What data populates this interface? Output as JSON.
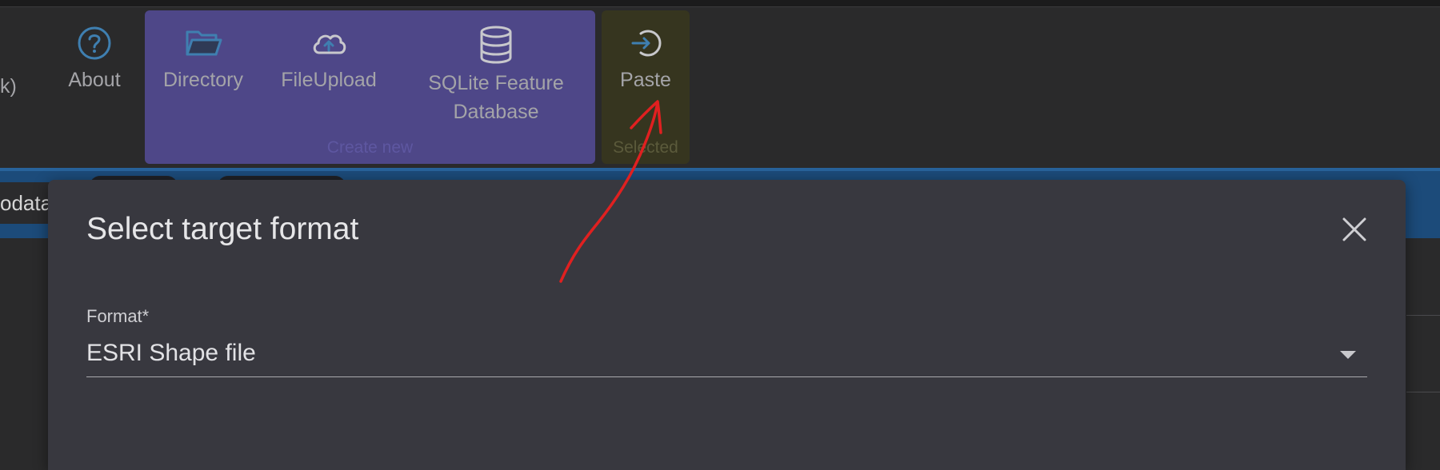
{
  "toolbar": {
    "partial_label": "k)",
    "about_label": "About",
    "create_group": {
      "label": "Create new",
      "items": [
        {
          "label": "Directory",
          "icon": "folder-icon"
        },
        {
          "label": "FileUpload",
          "icon": "cloud-upload-icon"
        },
        {
          "label_line1": "SQLite Feature",
          "label_line2": "Database",
          "icon": "database-icon"
        }
      ]
    },
    "selected_group": {
      "label": "Selected",
      "paste_label": "Paste",
      "paste_icon": "paste-arrow-icon"
    }
  },
  "tabs": {
    "partial_tab_label": "odata"
  },
  "dialog": {
    "title": "Select target format",
    "close_icon": "close-icon",
    "format_label": "Format*",
    "format_value": "ESRI Shape file"
  },
  "colors": {
    "create_group_bg": "#4e4788",
    "selected_group_bg": "#36351f",
    "accent_blue": "#1c4b7a",
    "icon_blue": "#3f7fb0",
    "annotation_red": "#e02020"
  }
}
